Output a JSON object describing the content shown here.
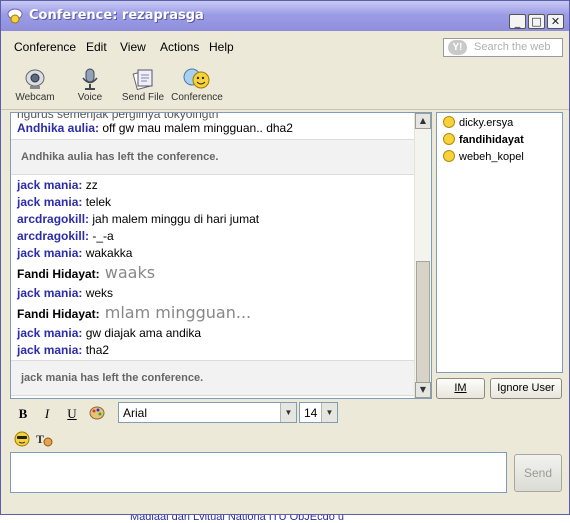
{
  "window": {
    "title": "Conference: rezaprasga"
  },
  "menu": [
    "Conference",
    "Edit",
    "View",
    "Actions",
    "Help"
  ],
  "search": {
    "placeholder": "Search the web",
    "logo": "Y!"
  },
  "toolbar": [
    {
      "label": "Webcam",
      "icon": "webcam-icon"
    },
    {
      "label": "Voice",
      "icon": "microphone-icon"
    },
    {
      "label": "Send File",
      "icon": "send-file-icon"
    },
    {
      "label": "Conference",
      "icon": "conference-icon"
    }
  ],
  "chat": {
    "partial_top": "ngurus semenjak pergiinya tokyoingth",
    "messages": [
      {
        "nick": "Andhika aulia:",
        "text": " off gw mau malem mingguan.. dha2",
        "style": "normal"
      },
      {
        "system": "Andhika aulia has left the conference."
      },
      {
        "nick": "jack mania:",
        "text": " zz",
        "style": "normal"
      },
      {
        "nick": "jack mania:",
        "text": " telek",
        "style": "normal"
      },
      {
        "nick": "arcdragokill:",
        "text": " jah malem minggu di hari jumat",
        "style": "normal"
      },
      {
        "nick": "arcdragokill:",
        "text": " -_-a",
        "style": "normal"
      },
      {
        "nick": "jack mania:",
        "text": " wakakka",
        "style": "normal"
      },
      {
        "nick": "Fandi Hidayat:",
        "text": " waaks",
        "style": "big"
      },
      {
        "nick": "jack mania:",
        "text": " weks",
        "style": "normal"
      },
      {
        "nick": "Fandi Hidayat:",
        "text": " mlam mingguan...",
        "style": "big"
      },
      {
        "nick": "jack mania:",
        "text": " gw diajak ama andika",
        "style": "normal"
      },
      {
        "nick": "jack mania:",
        "text": " tha2",
        "style": "normal"
      },
      {
        "system": "jack mania has left the conference."
      }
    ]
  },
  "buddies": [
    {
      "name": "dicky.ersya",
      "bold": false
    },
    {
      "name": "fandihidayat",
      "bold": true
    },
    {
      "name": "webeh_kopel",
      "bold": false
    }
  ],
  "buttons": {
    "im": "IM",
    "ignore": "Ignore User",
    "send": "Send"
  },
  "format": {
    "bold": "B",
    "italic": "I",
    "underline": "U",
    "font": "Arial",
    "size": "14"
  },
  "behind_window_text": "Madiaal dari Lvitual Nationa ITU ObJEcdo u"
}
